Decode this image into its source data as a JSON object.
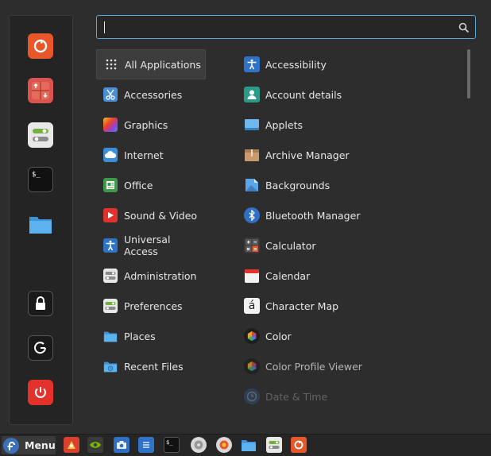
{
  "search": {
    "value": "",
    "placeholder": ""
  },
  "categories": [
    {
      "label": "All Applications",
      "icon": "grid-icon"
    },
    {
      "label": "Accessories",
      "icon": "scissors-icon"
    },
    {
      "label": "Graphics",
      "icon": "color-square-icon"
    },
    {
      "label": "Internet",
      "icon": "cloud-icon"
    },
    {
      "label": "Office",
      "icon": "document-icon"
    },
    {
      "label": "Sound & Video",
      "icon": "play-icon"
    },
    {
      "label": "Universal Access",
      "icon": "accessibility-icon"
    },
    {
      "label": "Administration",
      "icon": "toggle-icon"
    },
    {
      "label": "Preferences",
      "icon": "toggle-icon"
    },
    {
      "label": "Places",
      "icon": "folder-icon"
    },
    {
      "label": "Recent Files",
      "icon": "folder-clock-icon"
    }
  ],
  "apps": [
    {
      "label": "Accessibility",
      "icon": "accessibility-icon"
    },
    {
      "label": "Account details",
      "icon": "user-icon"
    },
    {
      "label": "Applets",
      "icon": "applets-icon"
    },
    {
      "label": "Archive Manager",
      "icon": "archive-icon"
    },
    {
      "label": "Backgrounds",
      "icon": "backgrounds-icon"
    },
    {
      "label": "Bluetooth Manager",
      "icon": "bluetooth-icon"
    },
    {
      "label": "Calculator",
      "icon": "calculator-icon"
    },
    {
      "label": "Calendar",
      "icon": "calendar-icon"
    },
    {
      "label": "Character Map",
      "icon": "character-map-icon"
    },
    {
      "label": "Color",
      "icon": "color-icon"
    },
    {
      "label": "Color Profile Viewer",
      "icon": "color-icon"
    },
    {
      "label": "Date & Time",
      "icon": "clock-icon"
    }
  ],
  "character_map_glyph": "á",
  "favorites": [
    "firefox-icon",
    "software-manager-icon",
    "settings-toggle-icon",
    "terminal-icon",
    "folder-icon",
    "lock-icon",
    "logout-icon",
    "power-icon"
  ],
  "panel": {
    "menu_label": "Menu",
    "launchers": [
      "gimp-icon",
      "nvidia-icon",
      "screenshot-icon",
      "text-editor-icon",
      "terminal-icon",
      "disks-icon",
      "firefox-icon",
      "files-icon",
      "settings-icon",
      "firefox-alt-icon"
    ]
  },
  "colors": {
    "accent": "#5aa6d6",
    "background": "#2d2d2d",
    "sidebar": "#242424",
    "panel": "#262626"
  }
}
